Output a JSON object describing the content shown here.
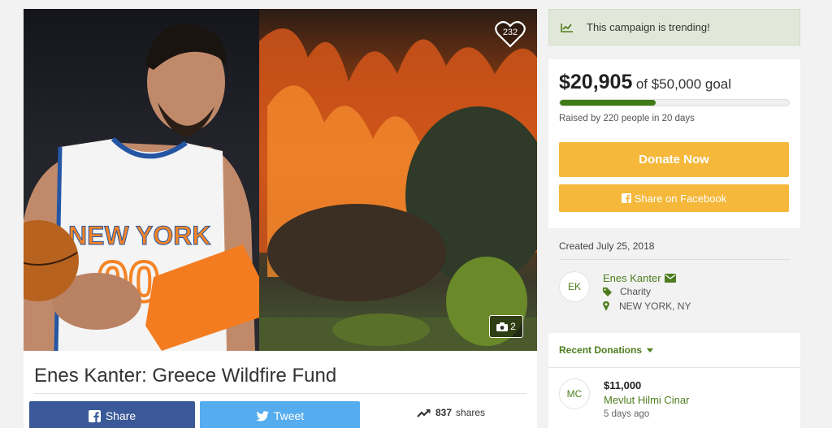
{
  "campaign": {
    "title": "Enes Kanter: Greece Wildfire Fund",
    "likes": "232",
    "photo_count": "2",
    "created": "Created July 25, 2018"
  },
  "share": {
    "facebook_label": "Share",
    "tweet_label": "Tweet",
    "share_count": "837",
    "share_word": "shares"
  },
  "trending": {
    "text": "This campaign is trending!"
  },
  "donate": {
    "raised": "$20,905",
    "goal_text": "of $50,000 goal",
    "progress_fraction": 0.418,
    "raised_by": "Raised by 220 people in 20 days",
    "donate_label": "Donate Now",
    "fb_share_label": "Share on Facebook"
  },
  "organizer": {
    "initials": "EK",
    "name": "Enes Kanter",
    "category": "Charity",
    "location": "NEW YORK, NY"
  },
  "recent": {
    "heading": "Recent Donations",
    "items": [
      {
        "initials": "MC",
        "amount": "$11,000",
        "name": "Mevlut Hilmi Cinar",
        "time": "5 days ago"
      }
    ]
  },
  "colors": {
    "brand_green": "#4d7d1e",
    "progress_green": "#3f7b16",
    "donate_yellow": "#f5b83b",
    "facebook_blue": "#3b5998",
    "twitter_blue": "#55acee"
  },
  "icons": [
    "heart-icon",
    "camera-icon",
    "facebook-icon",
    "twitter-icon",
    "trending-icon",
    "chart-line-icon",
    "envelope-icon",
    "tag-icon",
    "map-marker-icon",
    "caret-down-icon"
  ]
}
